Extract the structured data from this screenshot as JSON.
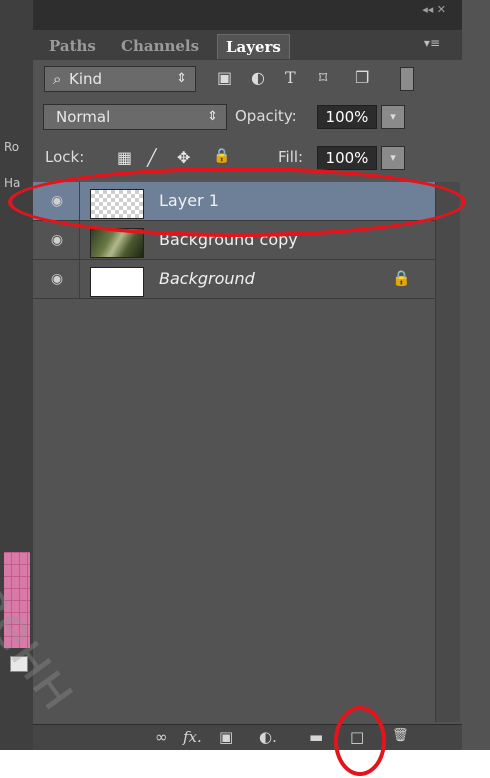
{
  "left_strip": {
    "label_1": "Ro",
    "label_2": "Ha"
  },
  "panel": {
    "window_controls": "◂◂ ✕",
    "menu_icon": "▾≡",
    "tabs": [
      {
        "label": "Paths",
        "active": false
      },
      {
        "label": "Channels",
        "active": false
      },
      {
        "label": "Layers",
        "active": true
      }
    ]
  },
  "filter": {
    "search_glyph": "⌕",
    "kind_label": "Kind",
    "kind_arrow": "⇕",
    "icons": [
      "image-filter-icon",
      "adjustment-filter-icon",
      "type-filter-icon",
      "shape-filter-icon",
      "smart-object-filter-icon"
    ],
    "glyphs": {
      "image": "▣",
      "adjust": "◐",
      "type": "T",
      "shape": "⌑",
      "smart": "❐"
    }
  },
  "blend": {
    "mode": "Normal",
    "mode_arrow": "⇕",
    "opacity_label": "Opacity:",
    "opacity_value": "100%",
    "dropdown_arrow": "▾"
  },
  "lock": {
    "label": "Lock:",
    "glyphs": {
      "pixels": "▦",
      "paint": "╱",
      "move": "✥",
      "all": "🔒"
    },
    "fill_label": "Fill:",
    "fill_value": "100%",
    "dropdown_arrow": "▾"
  },
  "layers": [
    {
      "name": "Layer 1",
      "italic": false,
      "selected": true,
      "thumb": "transparent",
      "locked": false
    },
    {
      "name": "Background copy",
      "italic": false,
      "selected": false,
      "thumb": "photo",
      "locked": false
    },
    {
      "name": "Background",
      "italic": true,
      "selected": false,
      "thumb": "white",
      "locked": true
    }
  ],
  "eye_glyph": "◉",
  "lock_glyph": "🔒",
  "bottom_bar": {
    "link": "∞",
    "fx": "fx.",
    "mask": "▣",
    "adjust": "◐.",
    "group": "▬",
    "new_layer": "□",
    "trash": "🗑"
  },
  "annotation_color": "#e4141c",
  "selection_color": "#6e7f98",
  "watermark": "венн"
}
